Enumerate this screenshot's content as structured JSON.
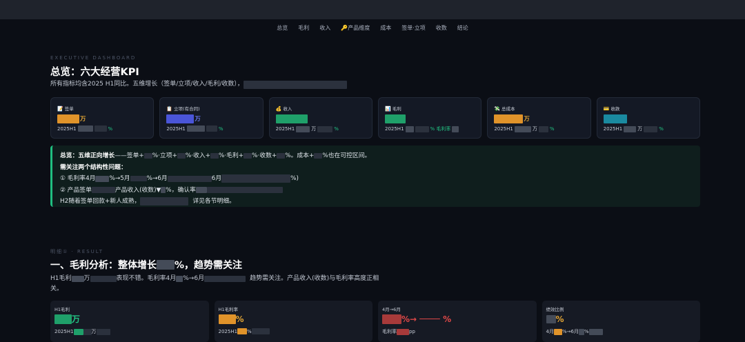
{
  "nav": [
    "总览",
    "毛利",
    "收入",
    "🔑产品维度",
    "成本",
    "签单·立项",
    "收数",
    "结论"
  ],
  "overview": {
    "eyebrow": "EXECUTIVE DASHBOARD",
    "title": "总览：六大经营KPI",
    "subtitle": "所有指标均含2025 H1同比。五维增长（签单/立项/收入/毛利/收数），"
  },
  "kpis": [
    {
      "icon": "📝",
      "label": "签单",
      "unit": "万",
      "prefix": "2025H1",
      "suffix": "",
      "pct": "%",
      "color": "#e0932a"
    },
    {
      "icon": "📋",
      "label": "立项(有合同)",
      "unit": "万",
      "prefix": "2025H1",
      "suffix": "",
      "pct": "%",
      "color": "#4a55d8"
    },
    {
      "icon": "💰",
      "label": "收入",
      "unit": "",
      "prefix": "2025H1",
      "suffix": "万",
      "pct": "%",
      "color": "#1fa06a"
    },
    {
      "icon": "📊",
      "label": "毛利",
      "unit": "",
      "prefix": "2025H1",
      "suffix": "",
      "pct": "% 毛利率",
      "color": "#1fa06a"
    },
    {
      "icon": "💸",
      "label": "总成本",
      "unit": "万",
      "prefix": "2025H1",
      "suffix": "万",
      "pct": "%",
      "color": "#e0932a"
    },
    {
      "icon": "💳",
      "label": "收款",
      "unit": "",
      "prefix": "2025H1",
      "suffix": "万",
      "pct": "%",
      "color": "#1a8aa0"
    }
  ],
  "summary": {
    "l1a": "总览：五维正向增长",
    "l1b": "——签单+",
    "l1c": "%·立项+",
    "l1d": "%·收入+",
    "l1e": "%·毛利+",
    "l1f": "%·收数+",
    "l1g": "%。成本+",
    "l1h": "%也在可控区间。",
    "l2": "需关注两个结构性问题：",
    "l3a": "① 毛利率4月",
    "l3b": "%→5月",
    "l3c": "%→6月",
    "l3d": "6月",
    "l3e": "%)",
    "l4a": "② 产品签单",
    "l4b": "产品收入(收数)▼",
    "l4c": "%，确认率",
    "l5a": "H2随着签单回款+新人成熟，",
    "l5b": "详见各节明细。"
  },
  "section1": {
    "eyebrow": "明细① · RESULT",
    "title": "一、毛利分析：整体增长",
    "title_end": "%，趋势需关注",
    "desc1a": "H1毛利",
    "desc1b": "万",
    "desc1c": "表现不错。毛利率4月",
    "desc1d": "%→6月",
    "desc1e": "趋势需关注。产品收入(收数)与毛利率高度正相",
    "desc2": "关。"
  },
  "cards2": [
    {
      "label": "H1毛利",
      "unit": "万",
      "foot_prefix": "2025H1",
      "foot_suffix": "万"
    },
    {
      "label": "H1毛利率",
      "unit": "%",
      "foot_prefix": "2025H1",
      "foot_suffix": "%"
    },
    {
      "label": "4月→6月",
      "unit": "%→",
      "unit2": "%",
      "foot_prefix": "毛利率",
      "foot_suffix": "pp"
    },
    {
      "label": "绩效比例",
      "unit": "%",
      "foot_prefix": "4月",
      "foot_suffix": "%→6月",
      "foot_suffix2": "%"
    }
  ]
}
